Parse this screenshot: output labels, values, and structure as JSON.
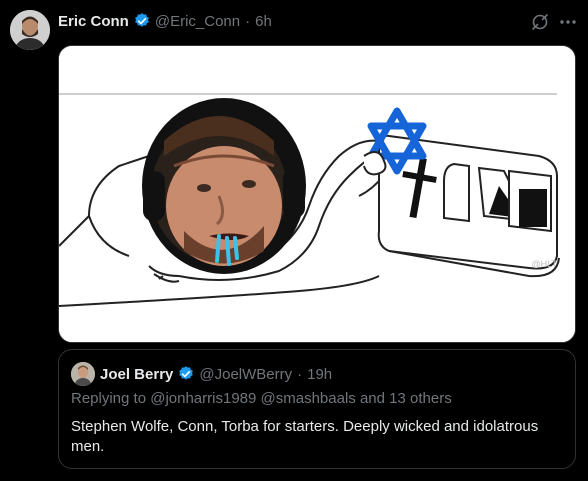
{
  "tweet": {
    "author_name": "Eric Conn",
    "handle": "@Eric_Conn",
    "separator": "·",
    "time": "6h",
    "verified_color": "#1d9bf0",
    "grok_icon": "grok-icon",
    "more_icon": "more-horizontal-icon"
  },
  "media": {
    "watermark": "@HLT"
  },
  "quote": {
    "author_name": "Joel Berry",
    "handle": "@JoelWBerry",
    "separator": "·",
    "time": "19h",
    "replying_prefix": "Replying to",
    "mention_1": "@jonharris1989",
    "mention_2": "@smashbaals",
    "replying_suffix": "and 13 others",
    "text": "Stephen Wolfe, Conn, Torba for starters. Deeply wicked and idolatrous men."
  }
}
